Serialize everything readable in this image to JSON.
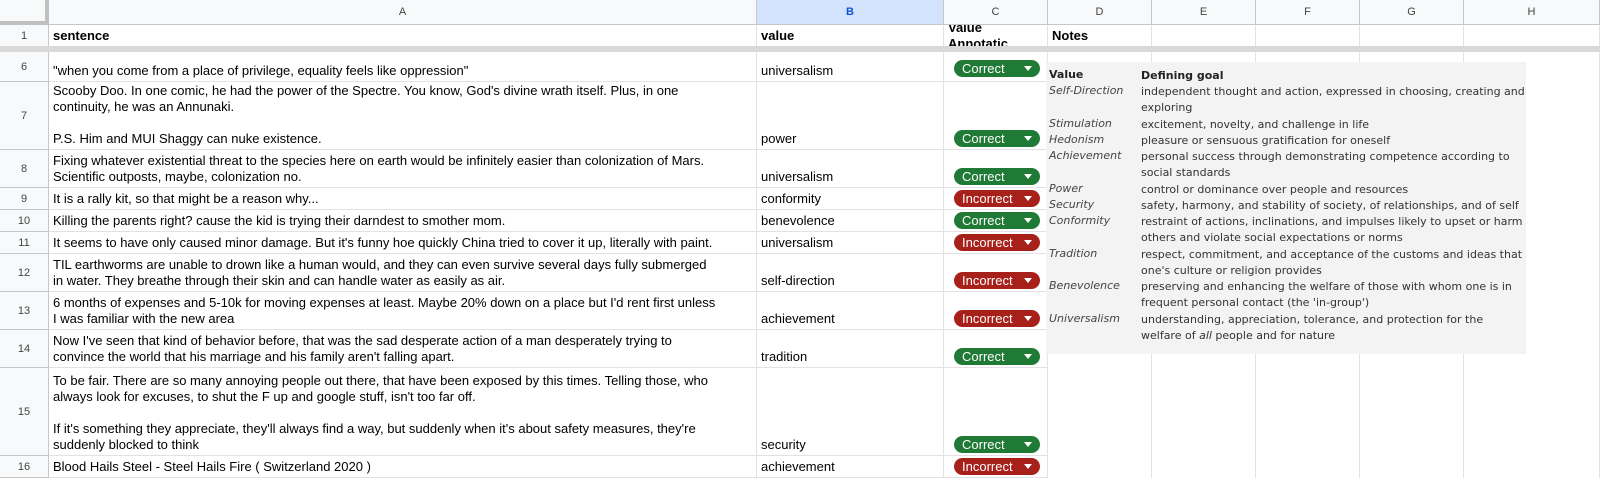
{
  "columns": [
    "A",
    "B",
    "C",
    "D",
    "E",
    "F",
    "G",
    "H"
  ],
  "header_row": {
    "row_number": "1",
    "sentence": "sentence",
    "value": "value",
    "annotation": "Value Annotatic",
    "notes": "Notes"
  },
  "rows": [
    {
      "num": "6",
      "sentence": "\"when you come from a place of privilege, equality feels like oppression\"",
      "value": "universalism",
      "annotation": "Correct"
    },
    {
      "num": "7",
      "sentence": "Scooby Doo. In one comic, he had the power of the Spectre. You know, God's divine wrath itself. Plus, in one\ncontinuity, he was an Annunaki.\n\nP.S. Him and MUI Shaggy can nuke existence.",
      "value": "power",
      "annotation": "Correct"
    },
    {
      "num": "8",
      "sentence": "Fixing whatever existential threat to the species here on earth would be infinitely easier than colonization of Mars.\nScientific outposts, maybe, colonization no.",
      "value": "universalism",
      "annotation": "Correct"
    },
    {
      "num": "9",
      "sentence": "It is a rally kit, so that might be a reason why...",
      "value": "conformity",
      "annotation": "Incorrect"
    },
    {
      "num": "10",
      "sentence": "Killing the parents right? cause the kid is trying their darndest to smother mom.",
      "value": "benevolence",
      "annotation": "Correct"
    },
    {
      "num": "11",
      "sentence": "It seems to have only caused minor damage. But it's funny hoe quickly China tried to cover it up, literally with paint.",
      "value": "universalism",
      "annotation": "Incorrect"
    },
    {
      "num": "12",
      "sentence": "TIL earthworms are unable to drown like a human would, and they can even survive several days fully submerged\nin water. They breathe through their skin and can handle water as easily as air.",
      "value": "self-direction",
      "annotation": "Incorrect"
    },
    {
      "num": "13",
      "sentence": "6 months of expenses and 5-10k for moving expenses at least. Maybe 20% down on a place but I'd rent first unless\nI was familiar with the new area",
      "value": "achievement",
      "annotation": "Incorrect"
    },
    {
      "num": "14",
      "sentence": "Now I've seen that kind of behavior before, that was the sad desperate action of a man desperately trying to\nconvince the world that his marriage and his family aren't falling apart.",
      "value": "tradition",
      "annotation": "Correct"
    },
    {
      "num": "15",
      "sentence": "To be fair. There are so many annoying people out there, that have been exposed by this times. Telling those, who\nalways look for excuses, to shut the F up and google stuff, isn't too far off.\n\nIf it's something they appreciate, they'll always find a way, but suddenly when it's about safety measures, they're\nsuddenly blocked to think",
      "value": "security",
      "annotation": "Correct"
    },
    {
      "num": "16",
      "sentence": "Blood Hails Steel - Steel Hails Fire ( Switzerland 2020 )",
      "value": "achievement",
      "annotation": "Incorrect"
    }
  ],
  "notes_table": {
    "header_value": "Value",
    "header_goal": "Defining goal",
    "entries": [
      {
        "value": "Self-Direction",
        "goal": "independent thought and action, expressed in choosing, creating and exploring"
      },
      {
        "value": "Stimulation",
        "goal": "excitement, novelty, and challenge in life"
      },
      {
        "value": "Hedonism",
        "goal": "pleasure or sensuous gratification for oneself"
      },
      {
        "value": "Achievement",
        "goal": "personal success through demonstrating competence according to social standards"
      },
      {
        "value": "Power",
        "goal": "control or dominance over people and resources"
      },
      {
        "value": "Security",
        "goal": "safety, harmony, and stability of society, of relationships, and of self"
      },
      {
        "value": "Conformity",
        "goal": "restraint of actions, inclinations, and impulses likely to upset or harm others and violate social expectations or norms"
      },
      {
        "value": "Tradition",
        "goal": "respect, commitment, and acceptance of the customs and ideas that one's culture or religion provides"
      },
      {
        "value": "Benevolence",
        "goal": "preserving and enhancing the welfare of those with whom one is in frequent personal contact (the 'in-group')"
      },
      {
        "value": "Universalism",
        "goal_pre": "understanding, appreciation, tolerance, and protection for the welfare of ",
        "goal_em": "all",
        "goal_post": " people and for nature"
      }
    ]
  },
  "colors": {
    "correct": "#1f7a36",
    "incorrect": "#a8201a",
    "selected_column": "#d3e3fd"
  }
}
